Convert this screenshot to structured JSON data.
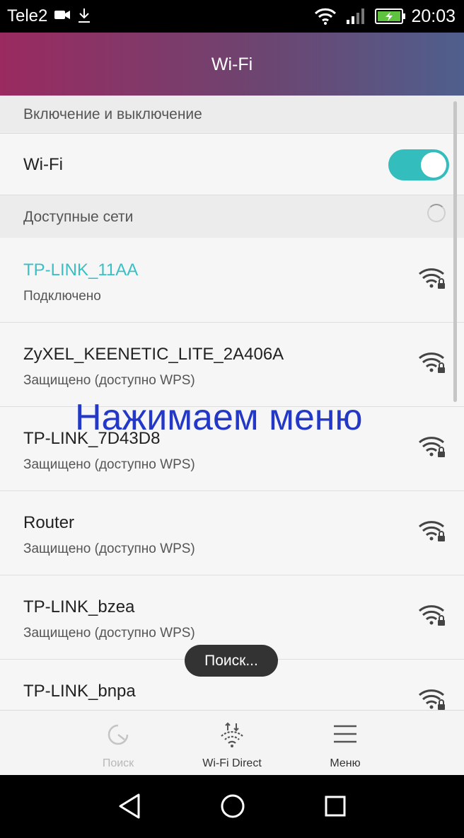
{
  "status_bar": {
    "carrier": "Tele2",
    "time": "20:03",
    "icons": [
      "video-camera-icon",
      "download-icon",
      "wifi-icon",
      "signal-icon",
      "battery-charging-icon"
    ]
  },
  "app_bar": {
    "title": "Wi-Fi"
  },
  "sections": {
    "toggle_header": "Включение и выключение",
    "wifi_label": "Wi-Fi",
    "wifi_enabled": true,
    "available_header": "Доступные сети"
  },
  "networks": [
    {
      "name": "TP-LINK_11AA",
      "status": "Подключено",
      "connected": true,
      "icon": "wifi-locked-icon"
    },
    {
      "name": "ZyXEL_KEENETIC_LITE_2A406A",
      "status": "Защищено (доступно WPS)",
      "connected": false,
      "icon": "wifi-locked-icon"
    },
    {
      "name": "TP-LINK_7D43D8",
      "status": "Защищено (доступно WPS)",
      "connected": false,
      "icon": "wifi-locked-icon"
    },
    {
      "name": "Router",
      "status": "Защищено (доступно WPS)",
      "connected": false,
      "icon": "wifi-locked-icon"
    },
    {
      "name": "TP-LINK_bzea",
      "status": "Защищено (доступно WPS)",
      "connected": false,
      "icon": "wifi-locked-icon"
    },
    {
      "name": "TP-LINK_bnpa",
      "status": "",
      "connected": false,
      "icon": "wifi-locked-icon"
    }
  ],
  "overlay_caption": "Нажимаем меню",
  "toast": "Поиск...",
  "bottom_bar": {
    "items": [
      {
        "label": "Поиск",
        "icon": "refresh-icon",
        "enabled": false
      },
      {
        "label": "Wi-Fi Direct",
        "icon": "wifi-direct-icon",
        "enabled": true
      },
      {
        "label": "Меню",
        "icon": "menu-icon",
        "enabled": true
      }
    ]
  },
  "nav_bar": {
    "buttons": [
      "back-icon",
      "home-icon",
      "recents-icon"
    ]
  },
  "colors": {
    "accent": "#33bdbd",
    "connected_text": "#3bbfc4",
    "caption": "#2438c8"
  }
}
